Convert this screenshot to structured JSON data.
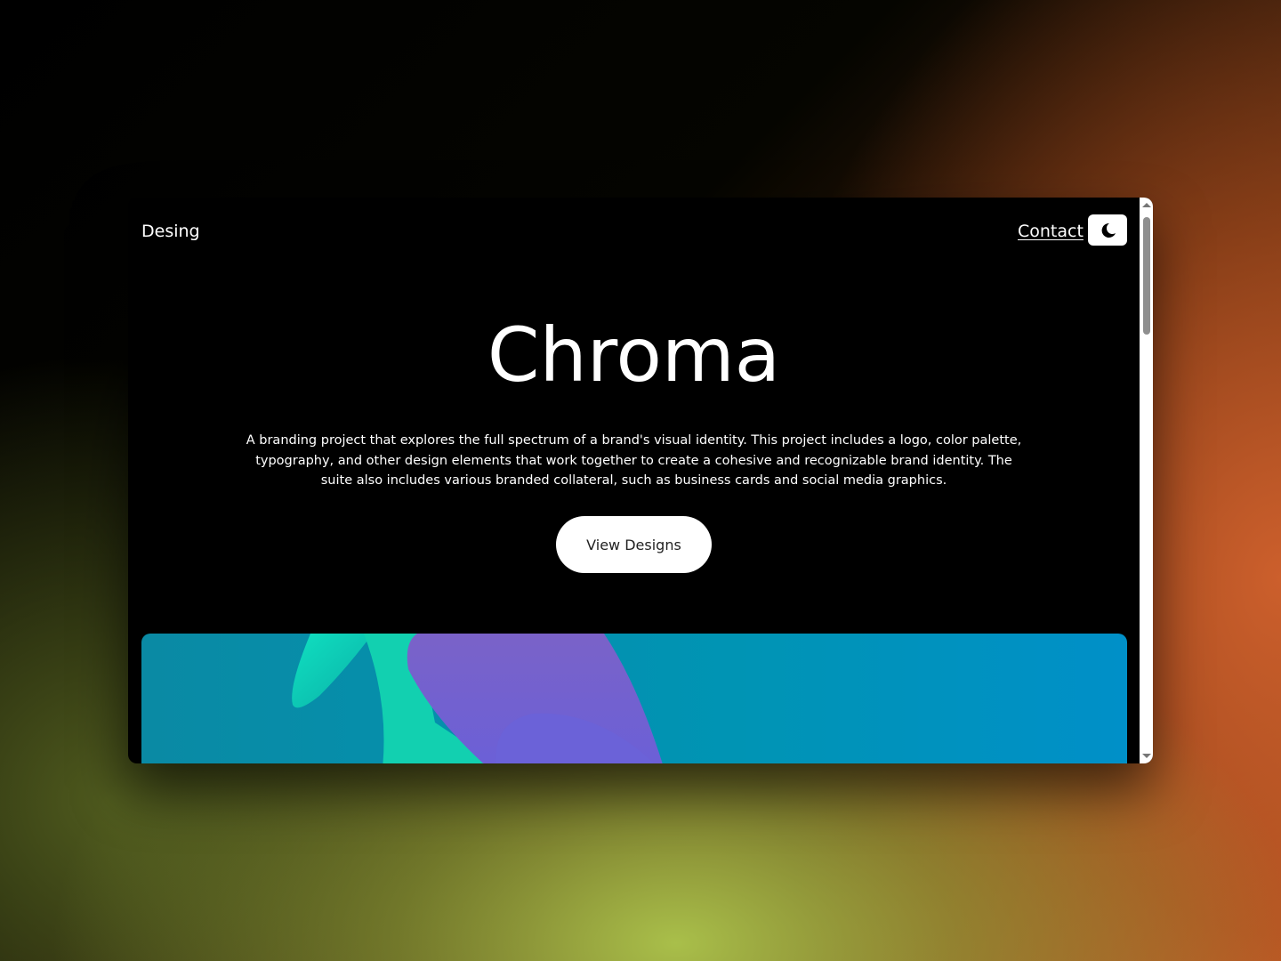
{
  "nav": {
    "brand": "Desing",
    "contact": "Contact",
    "theme_icon": "moon-icon"
  },
  "hero": {
    "title": "Chroma",
    "description": "A branding project that explores the full spectrum of a brand's visual identity. This project includes a logo, color palette, typography, and other design elements that work together to create a cohesive and recognizable brand identity. The suite also includes various branded collateral, such as business cards and social media graphics.",
    "cta": "View Designs"
  },
  "colors": {
    "background": "#000000",
    "accent_teal": "#0a8aa4",
    "accent_purple": "#7563cc",
    "accent_green": "#19d6b0"
  }
}
